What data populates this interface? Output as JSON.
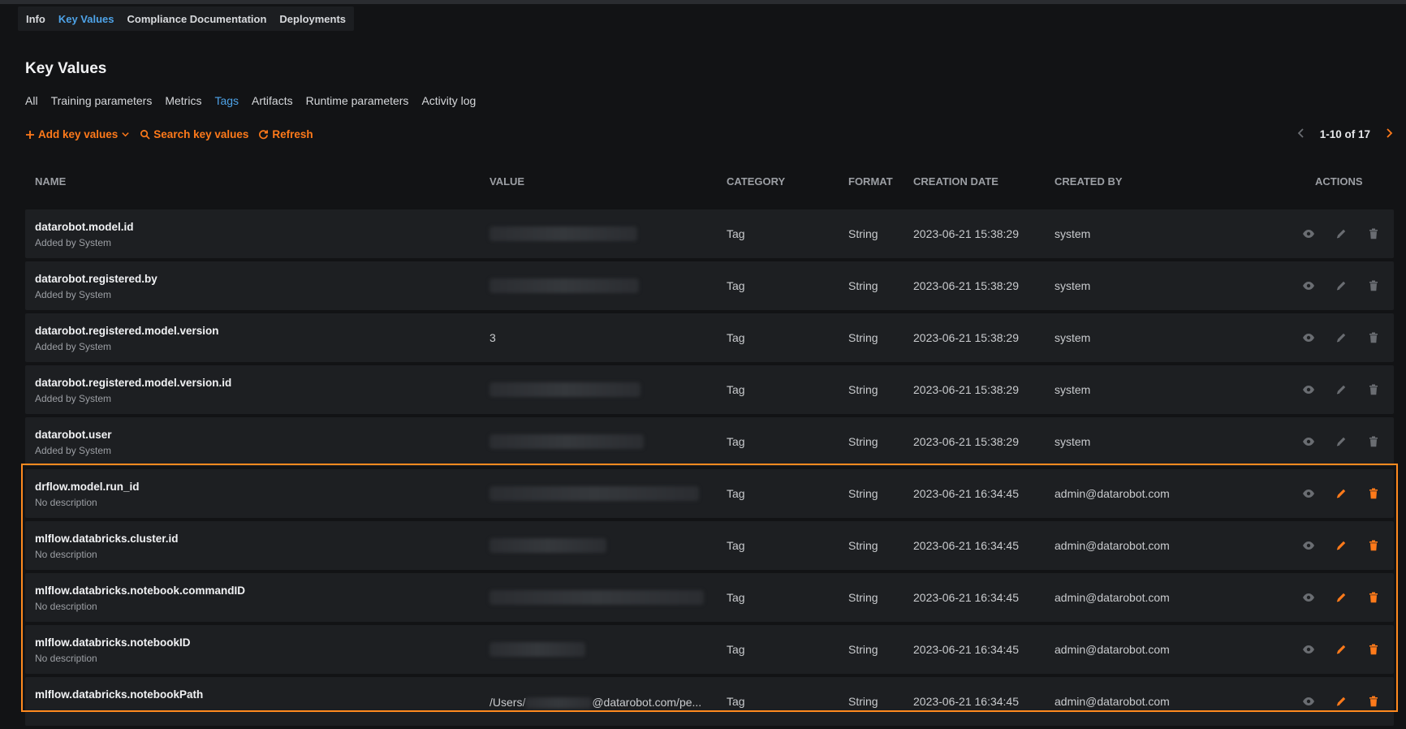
{
  "tabs": [
    {
      "label": "Info",
      "active": false
    },
    {
      "label": "Key Values",
      "active": true
    },
    {
      "label": "Compliance Documentation",
      "active": false
    },
    {
      "label": "Deployments",
      "active": false
    }
  ],
  "page_title": "Key Values",
  "subtabs": [
    {
      "label": "All",
      "active": false
    },
    {
      "label": "Training parameters",
      "active": false
    },
    {
      "label": "Metrics",
      "active": false
    },
    {
      "label": "Tags",
      "active": true
    },
    {
      "label": "Artifacts",
      "active": false
    },
    {
      "label": "Runtime parameters",
      "active": false
    },
    {
      "label": "Activity log",
      "active": false
    }
  ],
  "toolbar": {
    "add_label": "Add key values",
    "search_label": "Search key values",
    "refresh_label": "Refresh"
  },
  "pagination": {
    "range_label": "1-10 of 17"
  },
  "table": {
    "columns": [
      "NAME",
      "VALUE",
      "CATEGORY",
      "FORMAT",
      "CREATION DATE",
      "CREATED BY",
      "ACTIONS"
    ],
    "rows": [
      {
        "name": "datarobot.model.id",
        "description": "Added by System",
        "value": "",
        "category": "Tag",
        "format": "String",
        "created": "2023-06-21 15:38:29",
        "created_by": "system",
        "editable": false
      },
      {
        "name": "datarobot.registered.by",
        "description": "Added by System",
        "value": "",
        "category": "Tag",
        "format": "String",
        "created": "2023-06-21 15:38:29",
        "created_by": "system",
        "editable": false
      },
      {
        "name": "datarobot.registered.model.version",
        "description": "Added by System",
        "value": "3",
        "category": "Tag",
        "format": "String",
        "created": "2023-06-21 15:38:29",
        "created_by": "system",
        "editable": false
      },
      {
        "name": "datarobot.registered.model.version.id",
        "description": "Added by System",
        "value": "",
        "category": "Tag",
        "format": "String",
        "created": "2023-06-21 15:38:29",
        "created_by": "system",
        "editable": false
      },
      {
        "name": "datarobot.user",
        "description": "Added by System",
        "value": "",
        "category": "Tag",
        "format": "String",
        "created": "2023-06-21 15:38:29",
        "created_by": "system",
        "editable": false
      },
      {
        "name": "drflow.model.run_id",
        "description": "No description",
        "value": "",
        "category": "Tag",
        "format": "String",
        "created": "2023-06-21 16:34:45",
        "created_by": "admin@datarobot.com",
        "editable": true
      },
      {
        "name": "mlflow.databricks.cluster.id",
        "description": "No description",
        "value": "",
        "category": "Tag",
        "format": "String",
        "created": "2023-06-21 16:34:45",
        "created_by": "admin@datarobot.com",
        "editable": true
      },
      {
        "name": "mlflow.databricks.notebook.commandID",
        "description": "No description",
        "value": "",
        "category": "Tag",
        "format": "String",
        "created": "2023-06-21 16:34:45",
        "created_by": "admin@datarobot.com",
        "editable": true
      },
      {
        "name": "mlflow.databricks.notebookID",
        "description": "No description",
        "value": "",
        "category": "Tag",
        "format": "String",
        "created": "2023-06-21 16:34:45",
        "created_by": "admin@datarobot.com",
        "editable": true
      },
      {
        "name": "mlflow.databricks.notebookPath",
        "description": "",
        "value_prefix": "/Users/",
        "value_suffix": "@datarobot.com/pe...",
        "category": "Tag",
        "format": "String",
        "created": "2023-06-21 16:34:45",
        "created_by": "admin@datarobot.com",
        "editable": true
      }
    ]
  },
  "colors": {
    "accent": "#ff7a1a",
    "active_tab": "#4ea3e8",
    "highlight_border": "#ff8a1f"
  }
}
